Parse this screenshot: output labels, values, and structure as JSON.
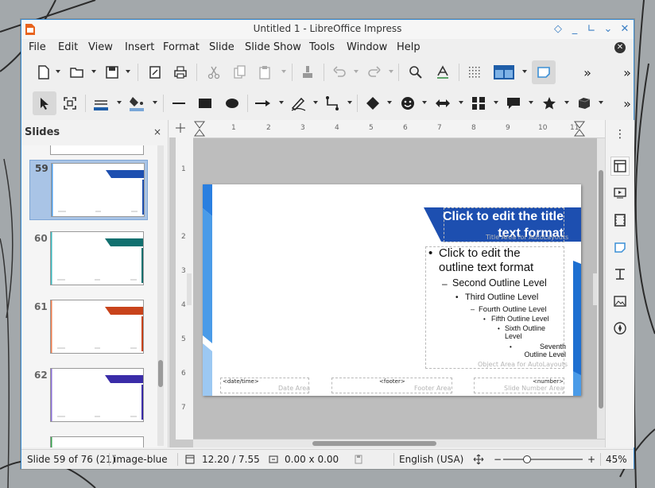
{
  "window": {
    "title": "Untitled 1 - LibreOffice Impress",
    "accent": "#3b8fd6"
  },
  "menu": {
    "items": [
      "File",
      "Edit",
      "View",
      "Insert",
      "Format",
      "Slide",
      "Slide Show",
      "Tools",
      "Window",
      "Help"
    ]
  },
  "toolbar1": {
    "icons": [
      "new-icon",
      "open-icon",
      "save-icon",
      "export-pdf-icon",
      "print-icon",
      "cut-icon",
      "copy-icon",
      "paste-icon",
      "clone-formatting-icon",
      "undo-icon",
      "redo-icon",
      "table-icon",
      "find-icon",
      "spelling-icon",
      "grid-icon",
      "display-views-icon",
      "presentation-icon",
      "more-icon"
    ]
  },
  "toolbar2": {
    "icons": [
      "select-icon",
      "zoom-pan-icon",
      "line-color-icon",
      "fill-color-icon",
      "line-icon",
      "rectangle-icon",
      "ellipse-icon",
      "lines-arrows-icon",
      "curves-icon",
      "connectors-icon",
      "basic-shapes-icon",
      "symbol-shapes-icon",
      "block-arrows-icon",
      "flowchart-icon",
      "callouts-icon",
      "stars-icon",
      "3d-objects-icon",
      "more-icon"
    ],
    "line_color": "#1f5ea8",
    "fill_color": "#7aa7d8"
  },
  "slides_pane": {
    "title": "Slides",
    "close": "×",
    "slides": [
      {
        "number": "59",
        "color": "#1d4fb0",
        "selected": true
      },
      {
        "number": "60",
        "color": "#11706f",
        "selected": false
      },
      {
        "number": "61",
        "color": "#c8431b",
        "selected": false
      },
      {
        "number": "62",
        "color": "#3a2ca8",
        "selected": false
      }
    ]
  },
  "ruler": {
    "top": [
      "1",
      "1",
      "2",
      "3",
      "4",
      "5",
      "6",
      "7",
      "8",
      "9",
      "10",
      "11"
    ],
    "left": [
      "1",
      "2",
      "3",
      "4",
      "5",
      "6",
      "7"
    ]
  },
  "slide": {
    "title_text": "Click to edit the title text format",
    "title_hint": "Title Area for AutoLayouts",
    "outline": [
      {
        "level": 1,
        "bullet": "•",
        "text": "Click to edit the outline text format"
      },
      {
        "level": 2,
        "bullet": "–",
        "text": "Second Outline Level"
      },
      {
        "level": 3,
        "bullet": "•",
        "text": "Third Outline Level"
      },
      {
        "level": 4,
        "bullet": "–",
        "text": "Fourth Outline Level"
      },
      {
        "level": 5,
        "bullet": "•",
        "text": "Fifth Outline Level"
      },
      {
        "level": 6,
        "bullet": "•",
        "text": "Sixth Outline Level"
      },
      {
        "level": 7,
        "bullet": "•",
        "text": "Seventh Outline Level"
      }
    ],
    "object_hint": "Object Area for AutoLayouts",
    "date_field": "<date/time>",
    "date_hint": "Date Area",
    "footer_field": "<footer>",
    "footer_hint": "Footer Area",
    "number_field": "<number>",
    "number_hint": "Slide Number Area",
    "accent": "#1d4fb0",
    "accent_light": "#4a9be8"
  },
  "sidebar": {
    "icons": [
      "more-options-icon",
      "properties-icon",
      "slide-transition-icon",
      "animation-icon",
      "master-slides-icon",
      "styles-icon",
      "gallery-icon",
      "navigator-icon"
    ]
  },
  "status": {
    "slide_info": "Slide 59 of 76 (21)",
    "master": "image-blue",
    "position": "12.20 / 7.55",
    "size": "0.00 x 0.00",
    "language": "English (USA)",
    "zoom_minus": "−",
    "zoom_plus": "+",
    "zoom": "45%",
    "zoom_fraction": 0.3
  }
}
